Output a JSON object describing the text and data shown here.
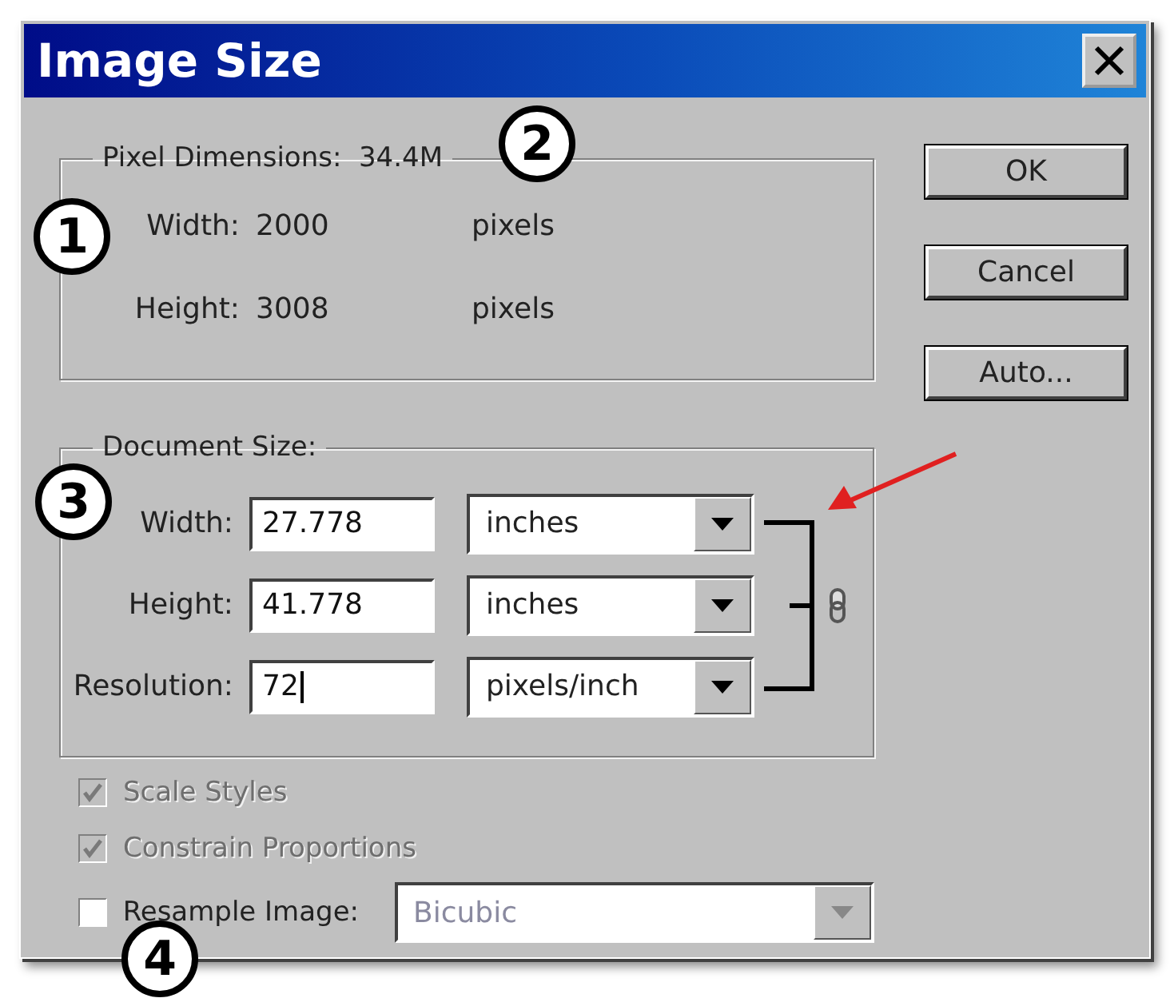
{
  "window": {
    "title": "Image Size"
  },
  "pixel_dimensions": {
    "label": "Pixel Dimensions:",
    "value": "34.4M",
    "rows": [
      {
        "label": "Width:",
        "value": "2000",
        "unit": "pixels"
      },
      {
        "label": "Height:",
        "value": "3008",
        "unit": "pixels"
      }
    ]
  },
  "document_size": {
    "label": "Document Size:",
    "linked": true,
    "rows": [
      {
        "label": "Width:",
        "value": "27.778",
        "unit": "inches",
        "focused": false
      },
      {
        "label": "Height:",
        "value": "41.778",
        "unit": "inches",
        "focused": false
      },
      {
        "label": "Resolution:",
        "value": "72",
        "unit": "pixels/inch",
        "focused": true
      }
    ]
  },
  "options": [
    {
      "label": "Scale Styles",
      "checked": true,
      "disabled": true
    },
    {
      "label": "Constrain Proportions",
      "checked": true,
      "disabled": true
    }
  ],
  "resample": {
    "label": "Resample Image:",
    "checked": false,
    "method": "Bicubic",
    "method_disabled": true
  },
  "buttons": [
    "OK",
    "Cancel",
    "Auto..."
  ],
  "callouts": [
    {
      "label": "1"
    },
    {
      "label": "2"
    },
    {
      "label": "3"
    },
    {
      "label": "4"
    }
  ]
}
